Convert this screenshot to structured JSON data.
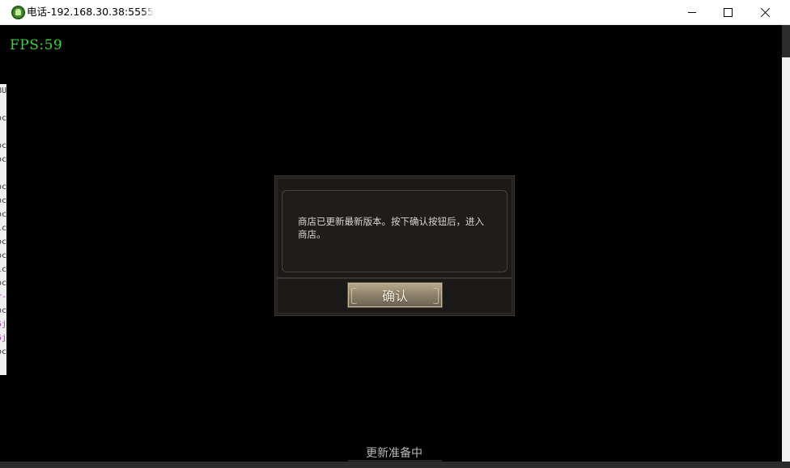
{
  "window": {
    "title": "电话-192.168.30.38:5555",
    "app_icon": "android-icon",
    "controls": {
      "minimize": "minimize-icon",
      "maximize": "maximize-icon",
      "close": "close-icon"
    }
  },
  "background_log": {
    "lines": [
      "BU",
      "",
      "oc",
      "",
      "oc",
      "oc",
      ":",
      "oc",
      "oc",
      "oc",
      "ic",
      "oc",
      "oc",
      "ic",
      "oc",
      "r-",
      "oc",
      "5j",
      "5j",
      "oc"
    ]
  },
  "game": {
    "fps_label": "FPS:59",
    "dialog": {
      "message": "商店已更新最新版本。按下确认按钮后，进入商店。",
      "confirm_label": "确认"
    },
    "status_text": "更新准备中"
  },
  "colors": {
    "fps": "#3ad63a",
    "dialog_bg": "#1b1a18",
    "button": "#a89b7e"
  }
}
